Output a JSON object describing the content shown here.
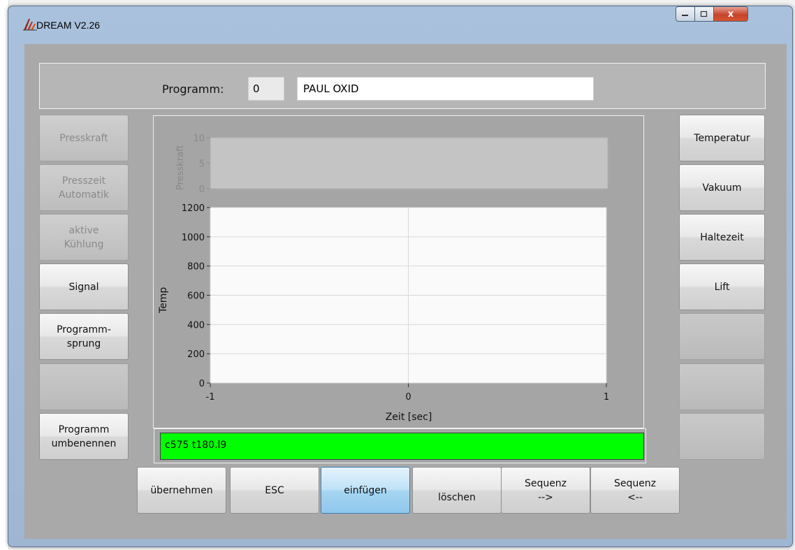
{
  "window": {
    "title": "DREAM V2.26",
    "accent": "#a7bedb",
    "close_label": "x"
  },
  "program": {
    "label": "Programm:",
    "number": "0",
    "name": "PAUL OXID"
  },
  "left_buttons": [
    {
      "label": "Presskraft",
      "enabled": false
    },
    {
      "label": "Presszeit\nAutomatik",
      "enabled": false
    },
    {
      "label": "aktive\nKühlung",
      "enabled": false
    },
    {
      "label": "Signal",
      "enabled": true
    },
    {
      "label": "Programm-\nsprung",
      "enabled": true
    },
    {
      "label": "",
      "enabled": false
    },
    {
      "label": "Programm\numbenennen",
      "enabled": true
    }
  ],
  "right_buttons": [
    {
      "label": "Temperatur",
      "enabled": true
    },
    {
      "label": "Vakuum",
      "enabled": true
    },
    {
      "label": "Haltezeit",
      "enabled": true
    },
    {
      "label": "Lift",
      "enabled": true
    },
    {
      "label": "",
      "enabled": false
    },
    {
      "label": "",
      "enabled": false
    },
    {
      "label": "",
      "enabled": false
    }
  ],
  "bottom_buttons": [
    {
      "label": "übernehmen",
      "selected": false
    },
    {
      "label": "ESC",
      "selected": false
    },
    {
      "label": "einfügen",
      "selected": true
    },
    {
      "label": "löschen",
      "selected": false
    },
    {
      "label": "Sequenz\n-->",
      "selected": false
    },
    {
      "label": "Sequenz\n<--",
      "selected": false
    }
  ],
  "sequence_text": "c575 t180.l9",
  "sequence_color": "#00ff00",
  "chart_data": [
    {
      "type": "line",
      "ylabel": "Presskraft",
      "ylim": [
        0,
        10
      ],
      "yticks": [
        "0",
        "5",
        "10"
      ],
      "enabled": false,
      "grid": true,
      "series": []
    },
    {
      "type": "line",
      "xlabel": "Zeit [sec]",
      "ylabel": "Temp",
      "xlim": [
        -1,
        1
      ],
      "ylim": [
        0,
        1200
      ],
      "xticks": [
        "-1",
        "0",
        "1"
      ],
      "yticks": [
        "0",
        "200",
        "400",
        "600",
        "800",
        "1000",
        "1200"
      ],
      "grid": true,
      "series": []
    }
  ]
}
